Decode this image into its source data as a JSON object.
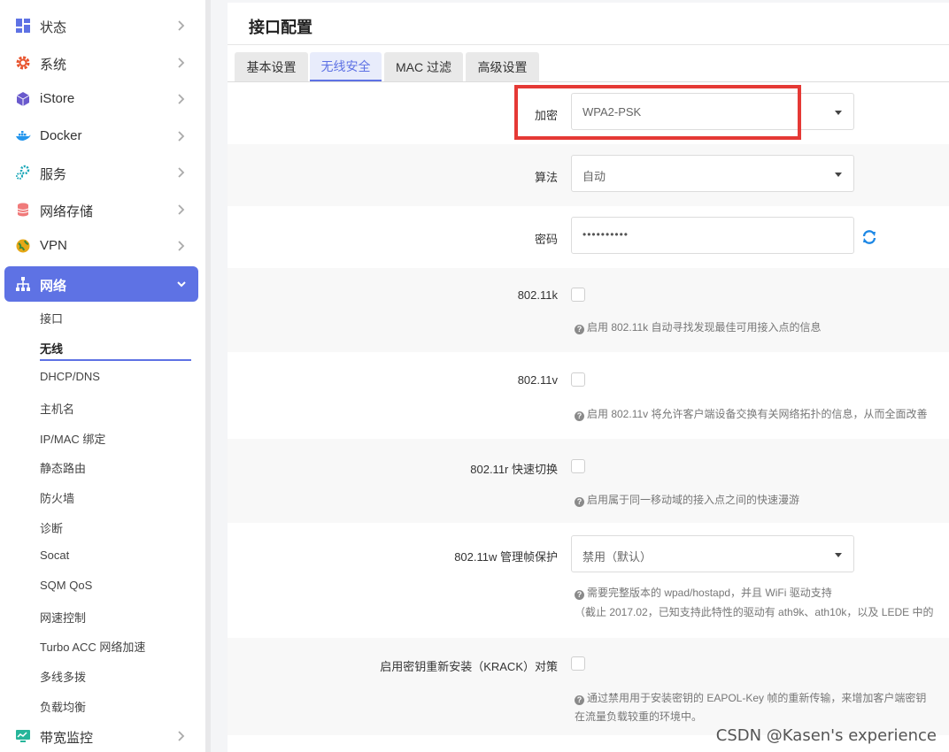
{
  "sidebar": {
    "items": [
      {
        "label": "状态",
        "icon": "dashboard-icon"
      },
      {
        "label": "系统",
        "icon": "gear-icon"
      },
      {
        "label": "iStore",
        "icon": "cube-icon"
      },
      {
        "label": "Docker",
        "icon": "docker-icon"
      },
      {
        "label": "服务",
        "icon": "services-icon"
      },
      {
        "label": "网络存储",
        "icon": "database-icon"
      },
      {
        "label": "VPN",
        "icon": "vpn-icon"
      },
      {
        "label": "网络",
        "icon": "network-icon"
      },
      {
        "label": "带宽监控",
        "icon": "monitor-icon"
      }
    ],
    "subitems": [
      "接口",
      "无线",
      "DHCP/DNS",
      "主机名",
      "IP/MAC 绑定",
      "静态路由",
      "防火墙",
      "诊断",
      "Socat",
      "SQM QoS",
      "网速控制",
      "Turbo ACC 网络加速",
      "多线多拨",
      "负载均衡"
    ],
    "active_item": "网络",
    "active_subitem": "无线",
    "accent_color": "#5e72e4"
  },
  "main": {
    "title": "接口配置",
    "tabs": [
      "基本设置",
      "无线安全",
      "MAC 过滤",
      "高级设置"
    ],
    "active_tab": "无线安全",
    "fields": {
      "encryption": {
        "label": "加密",
        "value": "WPA2-PSK"
      },
      "cipher": {
        "label": "算法",
        "value": "自动"
      },
      "password": {
        "label": "密码",
        "value": "••••••••••"
      },
      "k80211": {
        "label": "802.11k",
        "help": "启用 802.11k 自动寻找发现最佳可用接入点的信息"
      },
      "v80211": {
        "label": "802.11v",
        "help": "启用 802.11v 将允许客户端设备交换有关网络拓扑的信息，从而全面改善"
      },
      "r80211": {
        "label": "802.11r 快速切换",
        "help": "启用属于同一移动域的接入点之间的快速漫游"
      },
      "w80211": {
        "label": "802.11w 管理帧保护",
        "value": "禁用（默认）",
        "help": "需要完整版本的 wpad/hostapd，并且 WiFi 驱动支持",
        "help2": "（截止 2017.02，已知支持此特性的驱动有 ath9k、ath10k，以及 LEDE 中的"
      },
      "krack": {
        "label": "启用密钥重新安装（KRACK）对策",
        "help": "通过禁用用于安装密钥的 EAPOL-Key 帧的重新传输，来增加客户端密钥",
        "help2": "在流量负载较重的环境中。"
      }
    },
    "highlight_color": "#e53935"
  },
  "watermark": "CSDN @Kasen's experience"
}
